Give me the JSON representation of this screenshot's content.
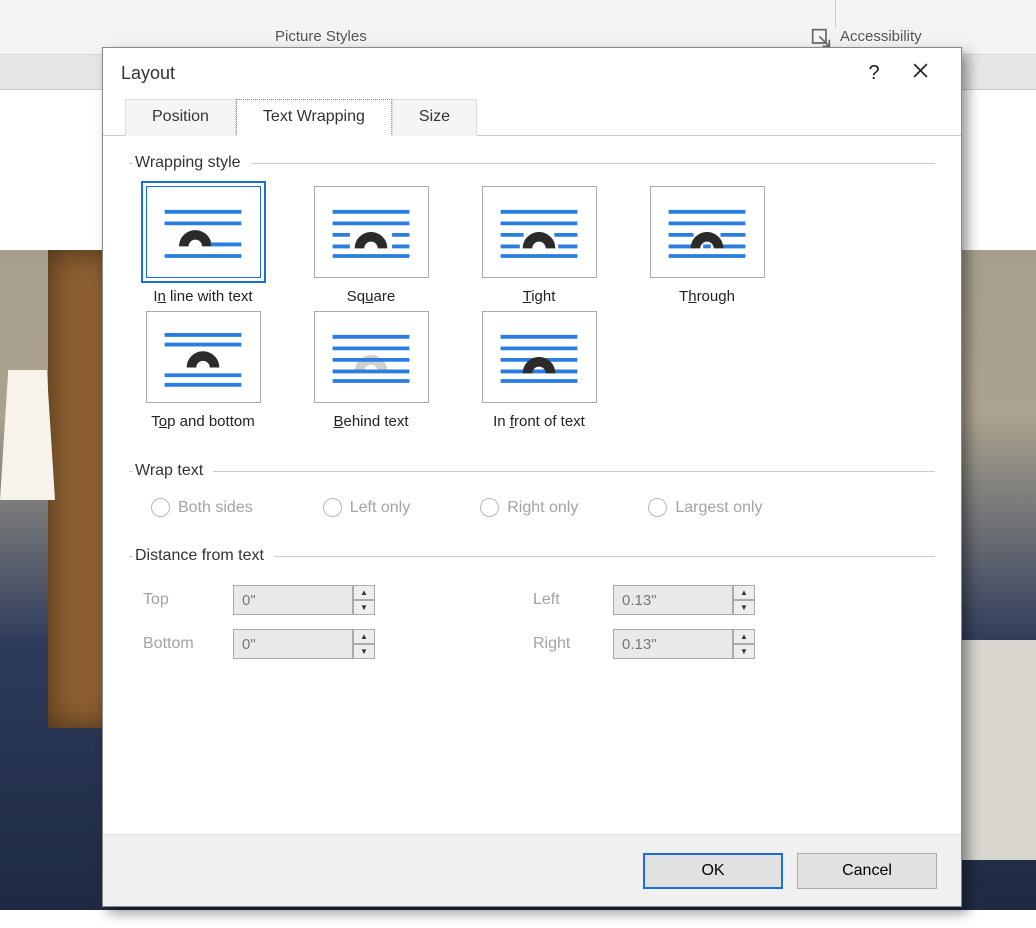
{
  "ribbon": {
    "picture_styles": "Picture Styles",
    "accessibility": "Accessibility"
  },
  "dialog": {
    "title": "Layout",
    "tabs": {
      "position": "Position",
      "text_wrapping": "Text Wrapping",
      "size": "Size"
    },
    "groups": {
      "wrapping_style": "Wrapping style",
      "wrap_text": "Wrap text",
      "distance": "Distance from text"
    },
    "styles": {
      "inline_pre": "I",
      "inline_u": "n",
      "inline_post": " line with text",
      "square_pre": "Sq",
      "square_u": "u",
      "square_post": "are",
      "tight_u": "T",
      "tight_post": "ight",
      "through_pre": "T",
      "through_u": "h",
      "through_post": "rough",
      "top_pre": "T",
      "top_u": "o",
      "top_post": "p and bottom",
      "behind_u": "B",
      "behind_post": "ehind text",
      "front_pre": "In ",
      "front_u": "f",
      "front_post": "ront of text"
    },
    "wrap_options": {
      "both": "Both sides",
      "left": "Left only",
      "right": "Right only",
      "largest": "Largest only"
    },
    "distance": {
      "top_label": "Top",
      "top_value": "0\"",
      "bottom_label": "Bottom",
      "bottom_value": "0\"",
      "left_label": "Left",
      "left_value": "0.13\"",
      "right_label": "Right",
      "right_value": "0.13\""
    },
    "buttons": {
      "ok": "OK",
      "cancel": "Cancel"
    }
  }
}
